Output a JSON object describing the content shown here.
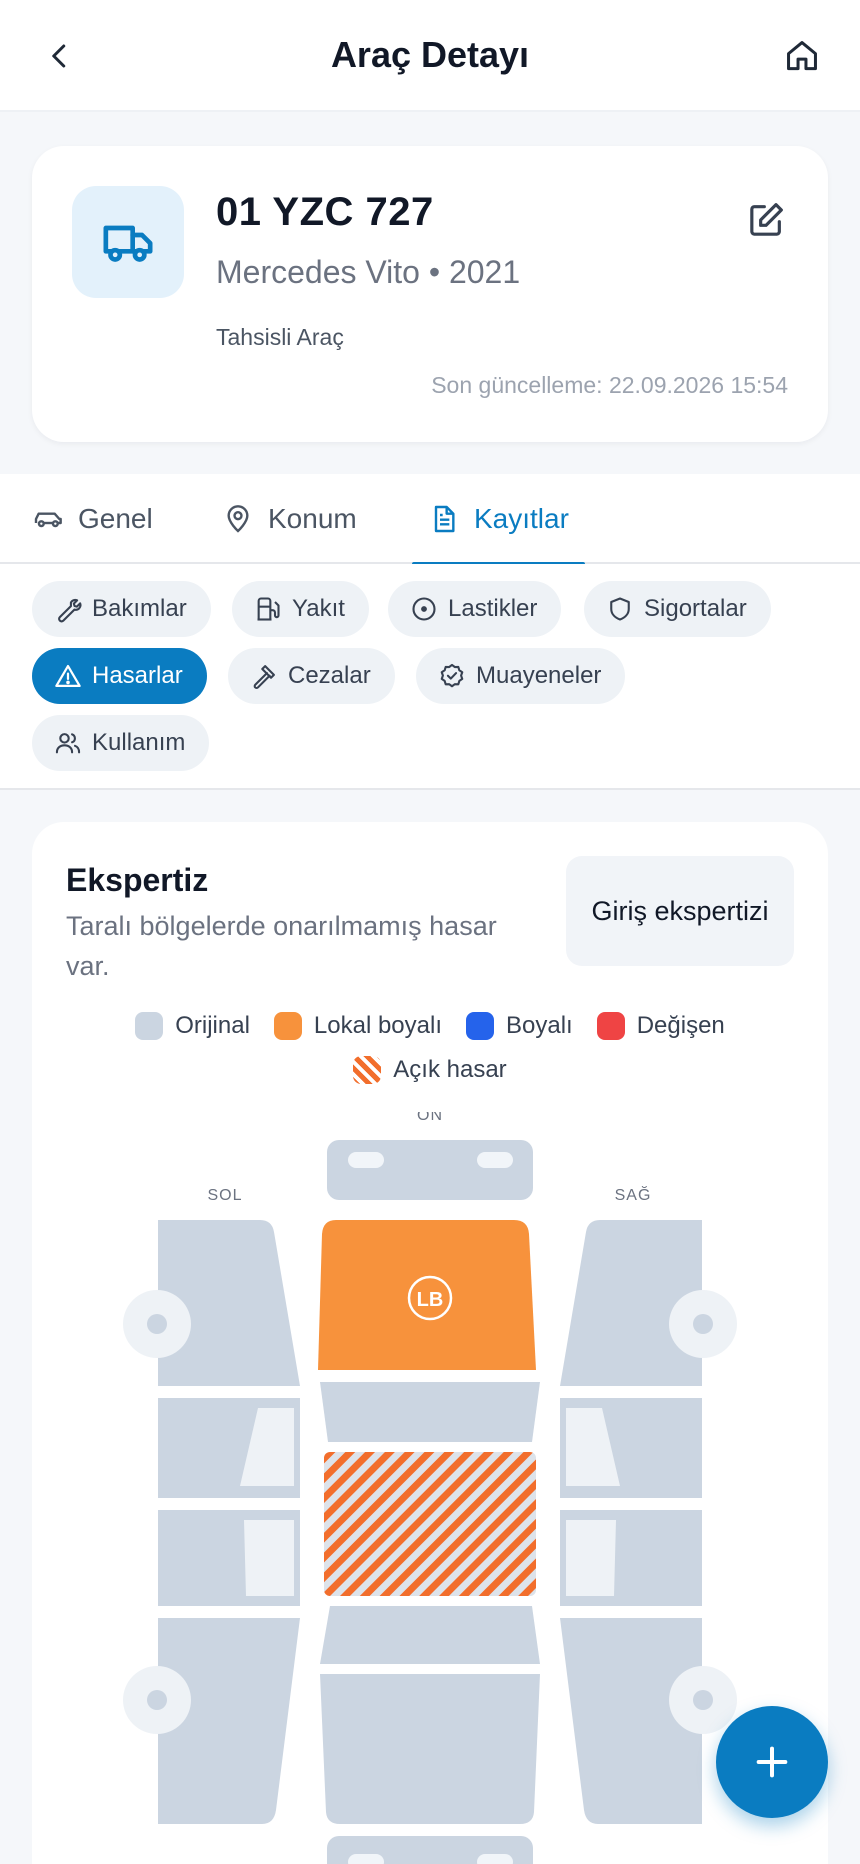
{
  "header": {
    "title": "Araç Detayı"
  },
  "vehicle": {
    "plate": "01 YZC 727",
    "model": "Mercedes Vito • 2021",
    "assignment": "Tahsisli Araç",
    "last_update": "Son güncelleme: 22.09.2026 15:54"
  },
  "tabs": [
    {
      "label": "Genel",
      "icon": "car-icon",
      "active": false
    },
    {
      "label": "Konum",
      "icon": "location-pin-icon",
      "active": false
    },
    {
      "label": "Kayıtlar",
      "icon": "document-icon",
      "active": true
    }
  ],
  "chips": [
    {
      "label": "Bakımlar",
      "icon": "wrench-icon",
      "active": false
    },
    {
      "label": "Yakıt",
      "icon": "fuel-pump-icon",
      "active": false
    },
    {
      "label": "Lastikler",
      "icon": "tire-icon",
      "active": false
    },
    {
      "label": "Sigortalar",
      "icon": "shield-icon",
      "active": false
    },
    {
      "label": "Hasarlar",
      "icon": "warning-icon",
      "active": true
    },
    {
      "label": "Cezalar",
      "icon": "gavel-icon",
      "active": false
    },
    {
      "label": "Muayeneler",
      "icon": "badge-check-icon",
      "active": false
    },
    {
      "label": "Kullanım",
      "icon": "users-icon",
      "active": false
    }
  ],
  "expertise": {
    "title": "Ekspertiz",
    "description": "Taralı bölgelerde onarılmamış hasar var.",
    "entry_button": "Giriş ekspertizi",
    "legend": [
      {
        "label": "Orijinal",
        "color": "#cbd5e1"
      },
      {
        "label": "Lokal boyalı",
        "color": "#f7923c"
      },
      {
        "label": "Boyalı",
        "color": "#2563eb"
      },
      {
        "label": "Değişen",
        "color": "#ef4444"
      },
      {
        "label": "Açık hasar",
        "color": "hatched-orange"
      }
    ],
    "diagram": {
      "label_front": "ÖN",
      "label_left": "SOL",
      "label_right": "SAĞ",
      "hood_badge": "LB",
      "hood_status": "Lokal boyalı",
      "roof_status": "Açık hasar"
    }
  },
  "fab": {
    "icon": "plus-icon"
  }
}
